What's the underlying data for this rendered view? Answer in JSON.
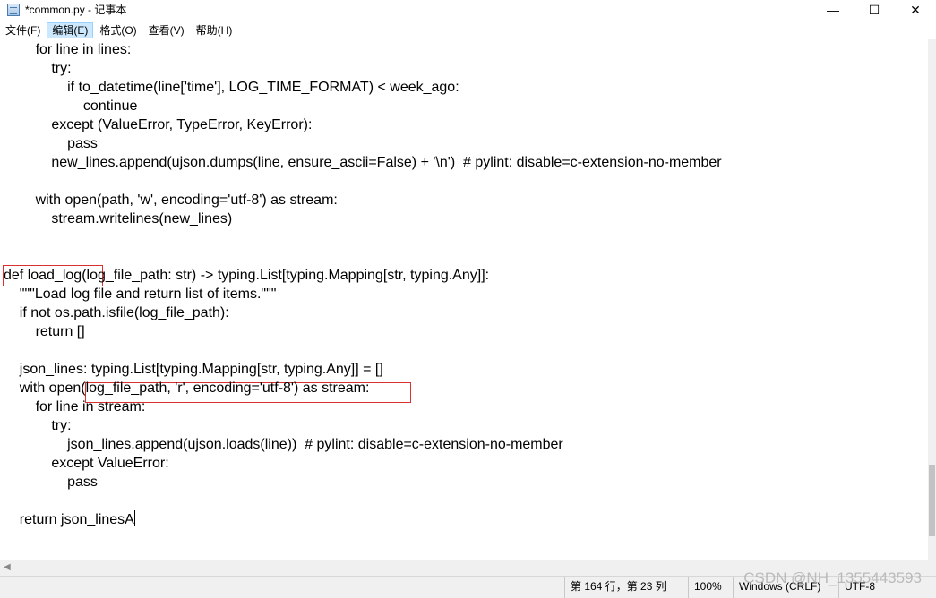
{
  "window": {
    "title": "*common.py - 记事本",
    "minimize_glyph": "—",
    "maximize_glyph": "☐",
    "close_glyph": "✕"
  },
  "menu": [
    {
      "label": "文件(F)"
    },
    {
      "label": "编辑(E)"
    },
    {
      "label": "格式(O)"
    },
    {
      "label": "查看(V)"
    },
    {
      "label": "帮助(H)"
    }
  ],
  "editor": {
    "lines": [
      "        for line in lines:",
      "            try:",
      "                if to_datetime(line['time'], LOG_TIME_FORMAT) < week_ago:",
      "                    continue",
      "            except (ValueError, TypeError, KeyError):",
      "                pass",
      "            new_lines.append(ujson.dumps(line, ensure_ascii=False) + '\\n')  # pylint: disable=c-extension-no-member",
      "",
      "        with open(path, 'w', encoding='utf-8') as stream:",
      "            stream.writelines(new_lines)",
      "",
      "",
      "def load_log(log_file_path: str) -> typing.List[typing.Mapping[str, typing.Any]]:",
      "    \"\"\"Load log file and return list of items.\"\"\"",
      "    if not os.path.isfile(log_file_path):",
      "        return []",
      "",
      "    json_lines: typing.List[typing.Mapping[str, typing.Any]] = []",
      "    with open(log_file_path, 'r', encoding='utf-8') as stream:",
      "        for line in stream:",
      "            try:",
      "                json_lines.append(ujson.loads(line))  # pylint: disable=c-extension-no-member",
      "            except ValueError:",
      "                pass",
      "",
      "    return json_linesA"
    ]
  },
  "accent": {
    "highlight_border": "#d93030",
    "active_menu_bg": "#cce8ff"
  },
  "status": {
    "position": "第 164 行，第 23 列",
    "zoom": "100%",
    "line_ending": "Windows (CRLF)",
    "encoding": "UTF-8"
  },
  "watermark": "CSDN @NH_1355443593"
}
